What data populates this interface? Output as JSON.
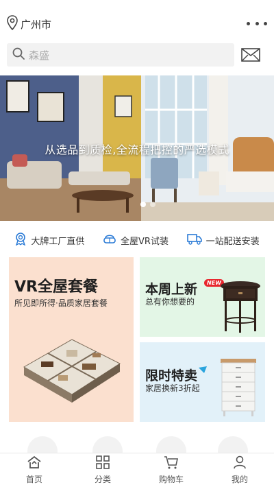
{
  "header": {
    "city": "广州市",
    "search_placeholder": "森盛"
  },
  "banner": {
    "caption": "从选品到质检,全流程把控的严选模式",
    "slides": 2,
    "active_slide": 1
  },
  "features": [
    {
      "icon": "badge-icon",
      "label": "大牌工厂直供"
    },
    {
      "icon": "vr-headset-icon",
      "label": "全屋VR试装"
    },
    {
      "icon": "delivery-truck-icon",
      "label": "一站配送安装"
    }
  ],
  "promos": {
    "vr": {
      "title": "VR全屋套餐",
      "subtitle": "所见即所得·品质家居套餐"
    },
    "new": {
      "title": "本周上新",
      "subtitle": "总有你想要的",
      "tag": "NEW"
    },
    "sale": {
      "title": "限时特卖",
      "subtitle": "家居换新3折起"
    }
  },
  "tabbar": [
    {
      "icon": "home-icon",
      "label": "首页"
    },
    {
      "icon": "category-icon",
      "label": "分类"
    },
    {
      "icon": "cart-icon",
      "label": "购物车"
    },
    {
      "icon": "user-icon",
      "label": "我的"
    }
  ],
  "colors": {
    "vr_bg": "#fbe0cf",
    "new_bg": "#e3f6e6",
    "sale_bg": "#e2f1f9",
    "accent_red": "#e8262d"
  }
}
